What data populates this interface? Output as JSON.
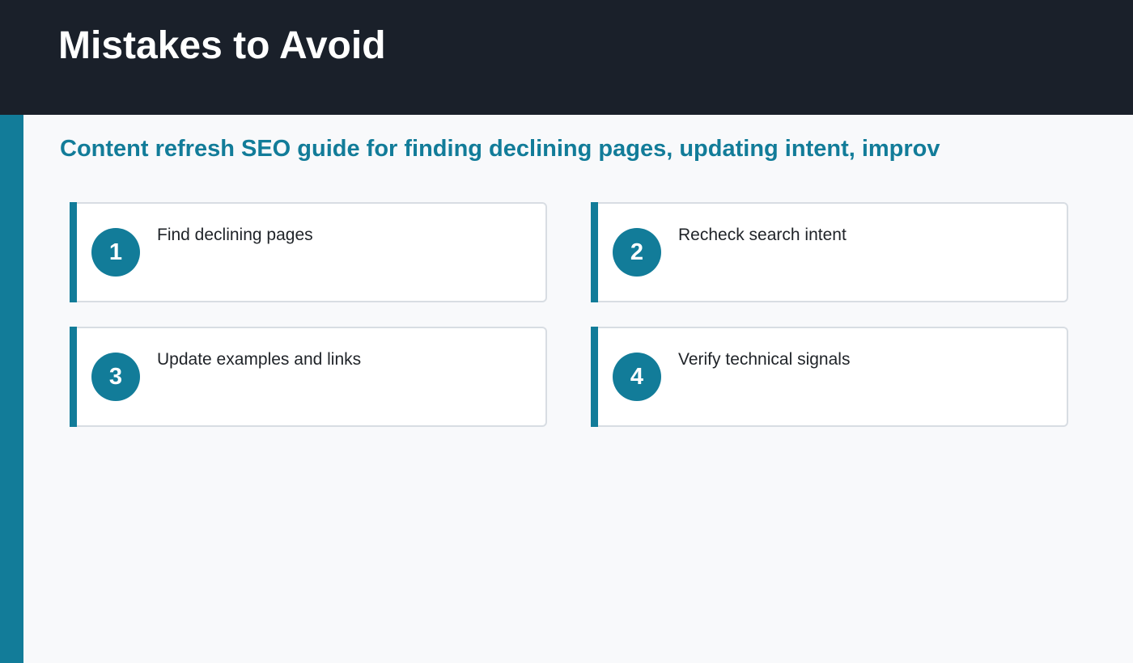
{
  "header": {
    "title": "Mistakes to Avoid"
  },
  "subtitle": "Content refresh SEO guide for finding declining pages, updating intent, improv",
  "cards": [
    {
      "number": "1",
      "label": "Find declining pages"
    },
    {
      "number": "2",
      "label": "Recheck search intent"
    },
    {
      "number": "3",
      "label": "Update examples and links"
    },
    {
      "number": "4",
      "label": "Verify technical signals"
    }
  ],
  "colors": {
    "header_bg": "#1a202a",
    "accent": "#127c99",
    "page_bg": "#f8f9fb",
    "card_border": "#d8dde3"
  }
}
